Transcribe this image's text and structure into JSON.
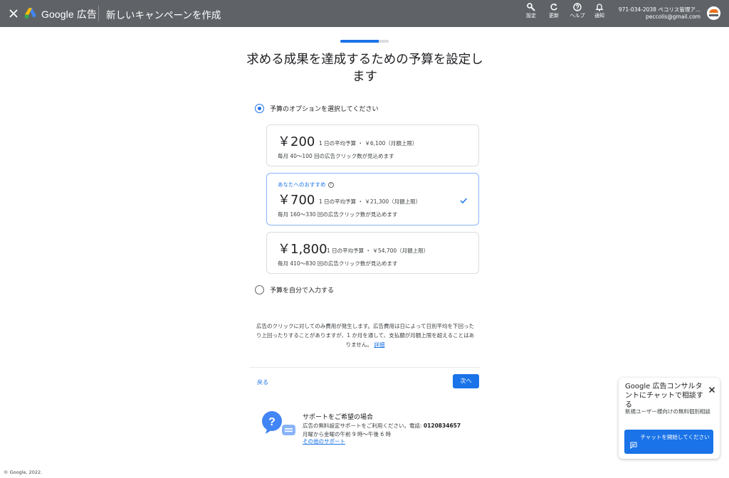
{
  "header": {
    "close_icon": "close-icon",
    "brand": "Google 広告",
    "page_title": "新しいキャンペーンを作成",
    "tools": [
      {
        "icon": "wrench-icon",
        "label": "設定"
      },
      {
        "icon": "refresh-icon",
        "label": "更新"
      },
      {
        "icon": "help-icon",
        "label": "ヘルプ"
      },
      {
        "icon": "bell-icon",
        "label": "通知"
      }
    ],
    "account_line1": "971-034-2038 ペコリス管理ア...",
    "account_line2": "peccolis@gmail.com"
  },
  "progress": {
    "fraction": 0.8
  },
  "title": "求める成果を達成するための予算を設定します",
  "options": {
    "preset_label": "予算のオプションを選択してください",
    "custom_label": "予算を自分で入力する",
    "selected": "preset"
  },
  "budgets": [
    {
      "amount": "￥200",
      "avg": "1 日の平均予算 ・ ￥6,100（月額上限）",
      "clicks": "毎月 40〜100 回の広告クリック数が見込めます",
      "selected": false
    },
    {
      "recommended": "あなたへのおすすめ",
      "amount": "￥700",
      "avg": "1 日の平均予算 ・ ￥21,300（月額上限）",
      "clicks": "毎月 160〜330 回の広告クリック数が見込めます",
      "selected": true
    },
    {
      "amount": "￥1,800",
      "avg": "1 日の平均予算 ・ ￥54,700（月額上限）",
      "clicks": "毎月 410〜830 回の広告クリック数が見込めます",
      "selected": false
    }
  ],
  "disclaimer": {
    "text": "広告のクリックに対してのみ費用が発生します。広告費用は日によって日別平均を下回ったり上回ったりすることがありますが、1 か月を通して、支払額が月額上限を超えることはありません。",
    "link": "詳細"
  },
  "nav": {
    "back": "戻る",
    "next": "次へ"
  },
  "support": {
    "title": "サポートをご希望の場合",
    "line1": "広告の無料設定サポートをご利用ください。電話:",
    "phone": "0120834657",
    "line2": "月曜から金曜の午前 9 時〜午後 6 時",
    "link": "その他のサポート"
  },
  "chat": {
    "title": "Google 広告コンサルタントにチャットで相談する",
    "subtitle": "新規ユーザー様向けの無料個別相談",
    "button": "チャットを開始してください"
  },
  "footer": "© Google, 2022."
}
